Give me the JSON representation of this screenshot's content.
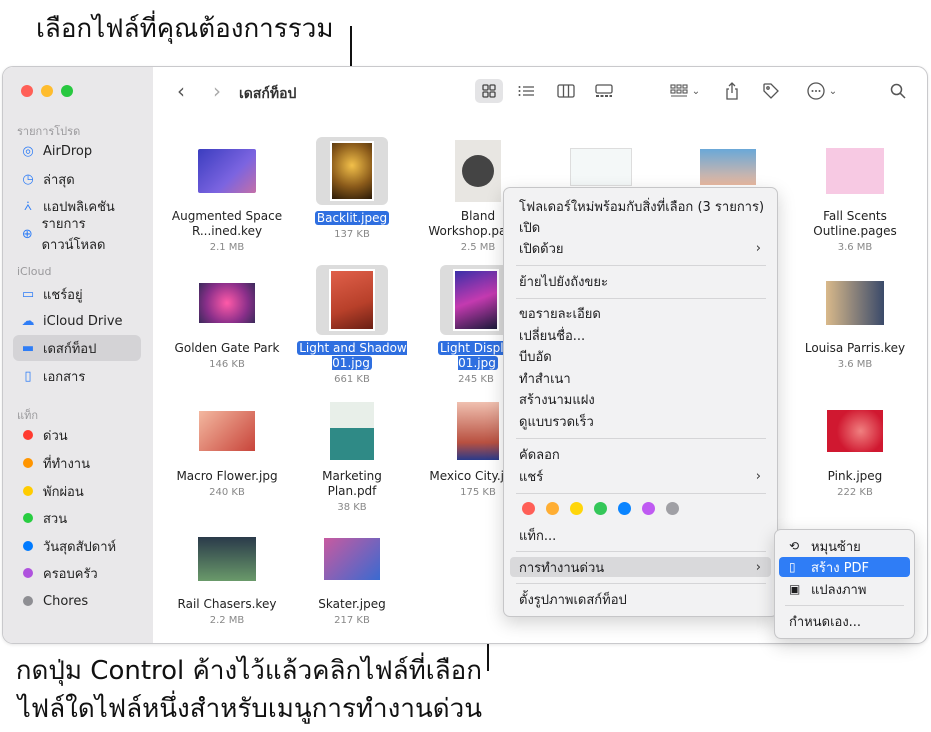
{
  "callouts": {
    "top": "เลือกไฟล์ที่คุณต้องการรวม",
    "bottom_line1": "กดปุ่ม Control ค้างไว้แล้วคลิกไฟล์ที่เลือก",
    "bottom_line2": "ไฟล์ใดไฟล์หนึ่งสำหรับเมนูการทำงานด่วน"
  },
  "window": {
    "title": "เดสก์ท็อป"
  },
  "sidebar": {
    "favorites_header": "รายการโปรด",
    "favorites": [
      {
        "label": "AirDrop",
        "icon": "airdrop-icon"
      },
      {
        "label": "ล่าสุด",
        "icon": "clock-icon"
      },
      {
        "label": "แอปพลิเคชัน",
        "icon": "applications-icon"
      },
      {
        "label": "รายการดาวน์โหลด",
        "icon": "download-icon"
      }
    ],
    "icloud_header": "iCloud",
    "icloud": [
      {
        "label": "แชร์อยู่",
        "icon": "shared-folder-icon"
      },
      {
        "label": "iCloud Drive",
        "icon": "cloud-icon"
      },
      {
        "label": "เดสก์ท็อป",
        "icon": "desktop-icon"
      },
      {
        "label": "เอกสาร",
        "icon": "document-icon"
      }
    ],
    "tags_header": "แท็ก",
    "tags": [
      {
        "label": "ด่วน",
        "color": "#ff3b30"
      },
      {
        "label": "ที่ทำงาน",
        "color": "#ff9500"
      },
      {
        "label": "พักผ่อน",
        "color": "#ffcc00"
      },
      {
        "label": "สวน",
        "color": "#28cd41"
      },
      {
        "label": "วันสุดสัปดาห์",
        "color": "#007aff"
      },
      {
        "label": "ครอบครัว",
        "color": "#af52de"
      },
      {
        "label": "Chores",
        "color": "#8e8e93"
      }
    ]
  },
  "files": [
    {
      "name": "Augmented Space R...ined.key",
      "size": "2.1 MB"
    },
    {
      "name": "Backlit.jpeg",
      "size": "137 KB"
    },
    {
      "name": "Bland Workshop.pages",
      "size": "2.5 MB"
    },
    {
      "name": "Fall Scents Outline.pages",
      "size": "3.6 MB"
    },
    {
      "name": "Golden Gate Park",
      "size": "146 KB"
    },
    {
      "name": "Light and Shadow 01.jpg",
      "size": "661 KB"
    },
    {
      "name": "Light Display 01.jpg",
      "size": "245 KB"
    },
    {
      "name": "Louisa Parris.key",
      "size": "3.6 MB"
    },
    {
      "name": "Macro Flower.jpg",
      "size": "240 KB"
    },
    {
      "name": "Marketing Plan.pdf",
      "size": "38 KB"
    },
    {
      "name": "Mexico City.jpeg",
      "size": "175 KB"
    },
    {
      "name": "Pink.jpeg",
      "size": "222 KB"
    },
    {
      "name": "Rail Chasers.key",
      "size": "2.2 MB"
    },
    {
      "name": "Skater.jpeg",
      "size": "217 KB"
    }
  ],
  "context_menu": {
    "items": [
      "โฟลเดอร์ใหม่พร้อมกับสิ่งที่เลือก (3 รายการ)",
      "เปิด",
      "เปิดด้วย",
      "ย้ายไปยังถังขยะ",
      "ขอรายละเอียด",
      "เปลี่ยนชื่อ...",
      "บีบอัด",
      "ทำสำเนา",
      "สร้างนามแฝง",
      "ดูแบบรวดเร็ว",
      "คัดลอก",
      "แชร์",
      "แท็ก...",
      "การทำงานด่วน",
      "ตั้งรูปภาพเดสก์ท็อป"
    ],
    "tag_colors": [
      "#ff5f57",
      "#ffae33",
      "#ffd60a",
      "#34c759",
      "#0a84ff",
      "#bf5af2",
      "#a0a0a5"
    ]
  },
  "submenu": {
    "items": [
      "หมุนซ้าย",
      "สร้าง PDF",
      "แปลงภาพ",
      "กำหนดเอง..."
    ]
  }
}
